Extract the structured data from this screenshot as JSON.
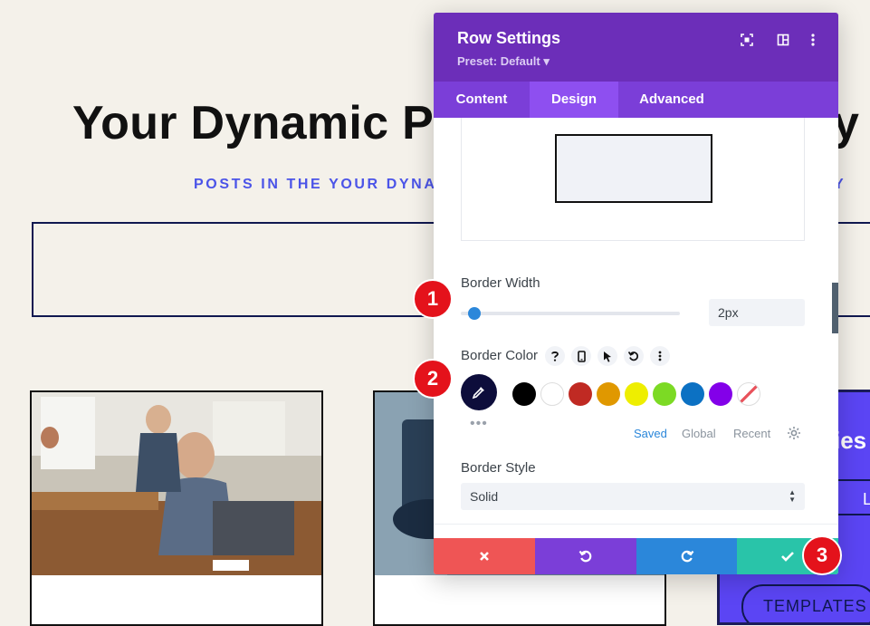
{
  "background": {
    "title": "Your Dynamic Po",
    "title_end": "y",
    "subtitle": "POSTS IN THE YOUR DYNAM",
    "subtitle_end": "Y",
    "promo_title": "ies",
    "promo_button": "LLAB",
    "promo_button2": "TEMPLATES"
  },
  "modal": {
    "title": "Row Settings",
    "preset": "Preset: Default ▾",
    "header_icons": [
      "focus-icon",
      "split-view-icon",
      "more-icon"
    ],
    "tabs": [
      {
        "label": "Content",
        "active": false
      },
      {
        "label": "Design",
        "active": true
      },
      {
        "label": "Advanced",
        "active": false
      }
    ],
    "border_width": {
      "label": "Border Width",
      "value": "2px",
      "slider_fraction": 0.06
    },
    "border_color": {
      "label": "Border Color",
      "option_icons": [
        "help-icon",
        "mobile-icon",
        "hover-cursor-icon",
        "reset-icon",
        "more-options-icon"
      ],
      "selected": "#0d0d3b",
      "swatches": [
        "#000000",
        "#ffffff",
        "#c02a23",
        "#e09800",
        "#eeee00",
        "#7cda24",
        "#0c71c3",
        "#8300e9",
        "transparent"
      ],
      "palette_tabs": [
        "Saved",
        "Global",
        "Recent"
      ],
      "active_palette": "Saved"
    },
    "border_style": {
      "label": "Border Style",
      "value": "Solid"
    },
    "footer": {
      "cancel_color": "#ef5555",
      "undo_color": "#7b3ed8",
      "redo_color": "#2b87da",
      "save_color": "#29c4a9"
    }
  },
  "steps": [
    "1",
    "2",
    "3"
  ],
  "colors": {
    "header": "#6c2eb9",
    "tab_bar": "#7b3ed8",
    "active_tab": "#8e4ff0",
    "accent": "#2b87da",
    "step_badge": "#e4121b"
  }
}
